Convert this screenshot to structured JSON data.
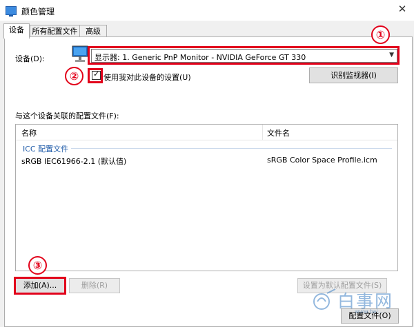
{
  "window": {
    "title": "颜色管理"
  },
  "tabs": [
    {
      "label": "设备"
    },
    {
      "label": "所有配置文件"
    },
    {
      "label": "高级"
    }
  ],
  "device": {
    "label": "设备(D):",
    "selected": "显示器: 1. Generic PnP Monitor - NVIDIA GeForce GT 330",
    "use_my_settings_label": "使用我对此设备的设置(U)",
    "use_my_settings_checked": true,
    "identify_button": "识别监视器(I)"
  },
  "profiles": {
    "label": "与这个设备关联的配置文件(F):",
    "columns": [
      "名称",
      "文件名"
    ],
    "group": "ICC 配置文件",
    "rows": [
      {
        "name": "sRGB IEC61966-2.1 (默认值)",
        "file": "sRGB Color Space Profile.icm"
      }
    ]
  },
  "buttons": {
    "add": "添加(A)...",
    "remove": "删除(R)",
    "set_default": "设置为默认配置文件(S)",
    "profiles_bottom": "配置文件(O)"
  },
  "annotations": {
    "badge1": "①",
    "badge2": "②",
    "badge3": "③",
    "color": "#e2001a"
  },
  "watermark": {
    "text": "白事网",
    "url": "www.bai..."
  }
}
